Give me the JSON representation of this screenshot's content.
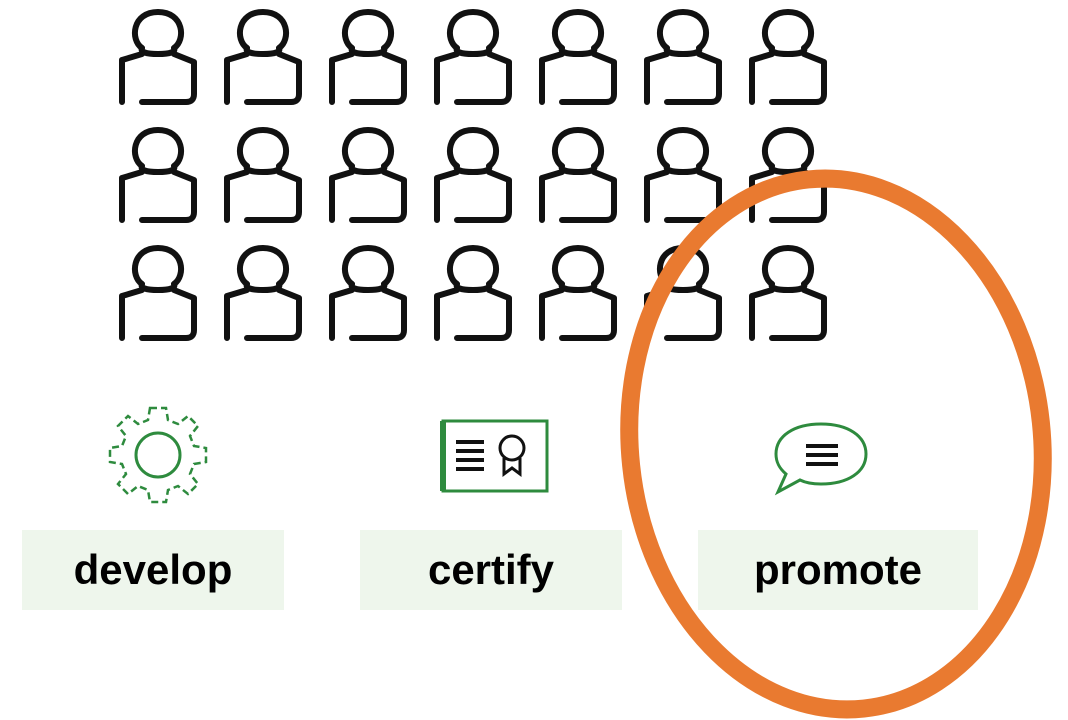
{
  "colors": {
    "person_stroke": "#111111",
    "icon_green": "#2e8b3e",
    "label_bg": "#eef6ec",
    "highlight": "#e97a30"
  },
  "people_grid": {
    "rows": 3,
    "cols": 7,
    "icon": "person-outline-icon"
  },
  "steps": [
    {
      "id": "develop",
      "label": "develop",
      "icon": "gear-icon"
    },
    {
      "id": "certify",
      "label": "certify",
      "icon": "certificate-icon"
    },
    {
      "id": "promote",
      "label": "promote",
      "icon": "speech-bubble-icon"
    }
  ],
  "highlight": {
    "target": "promote",
    "shape": "ellipse"
  }
}
